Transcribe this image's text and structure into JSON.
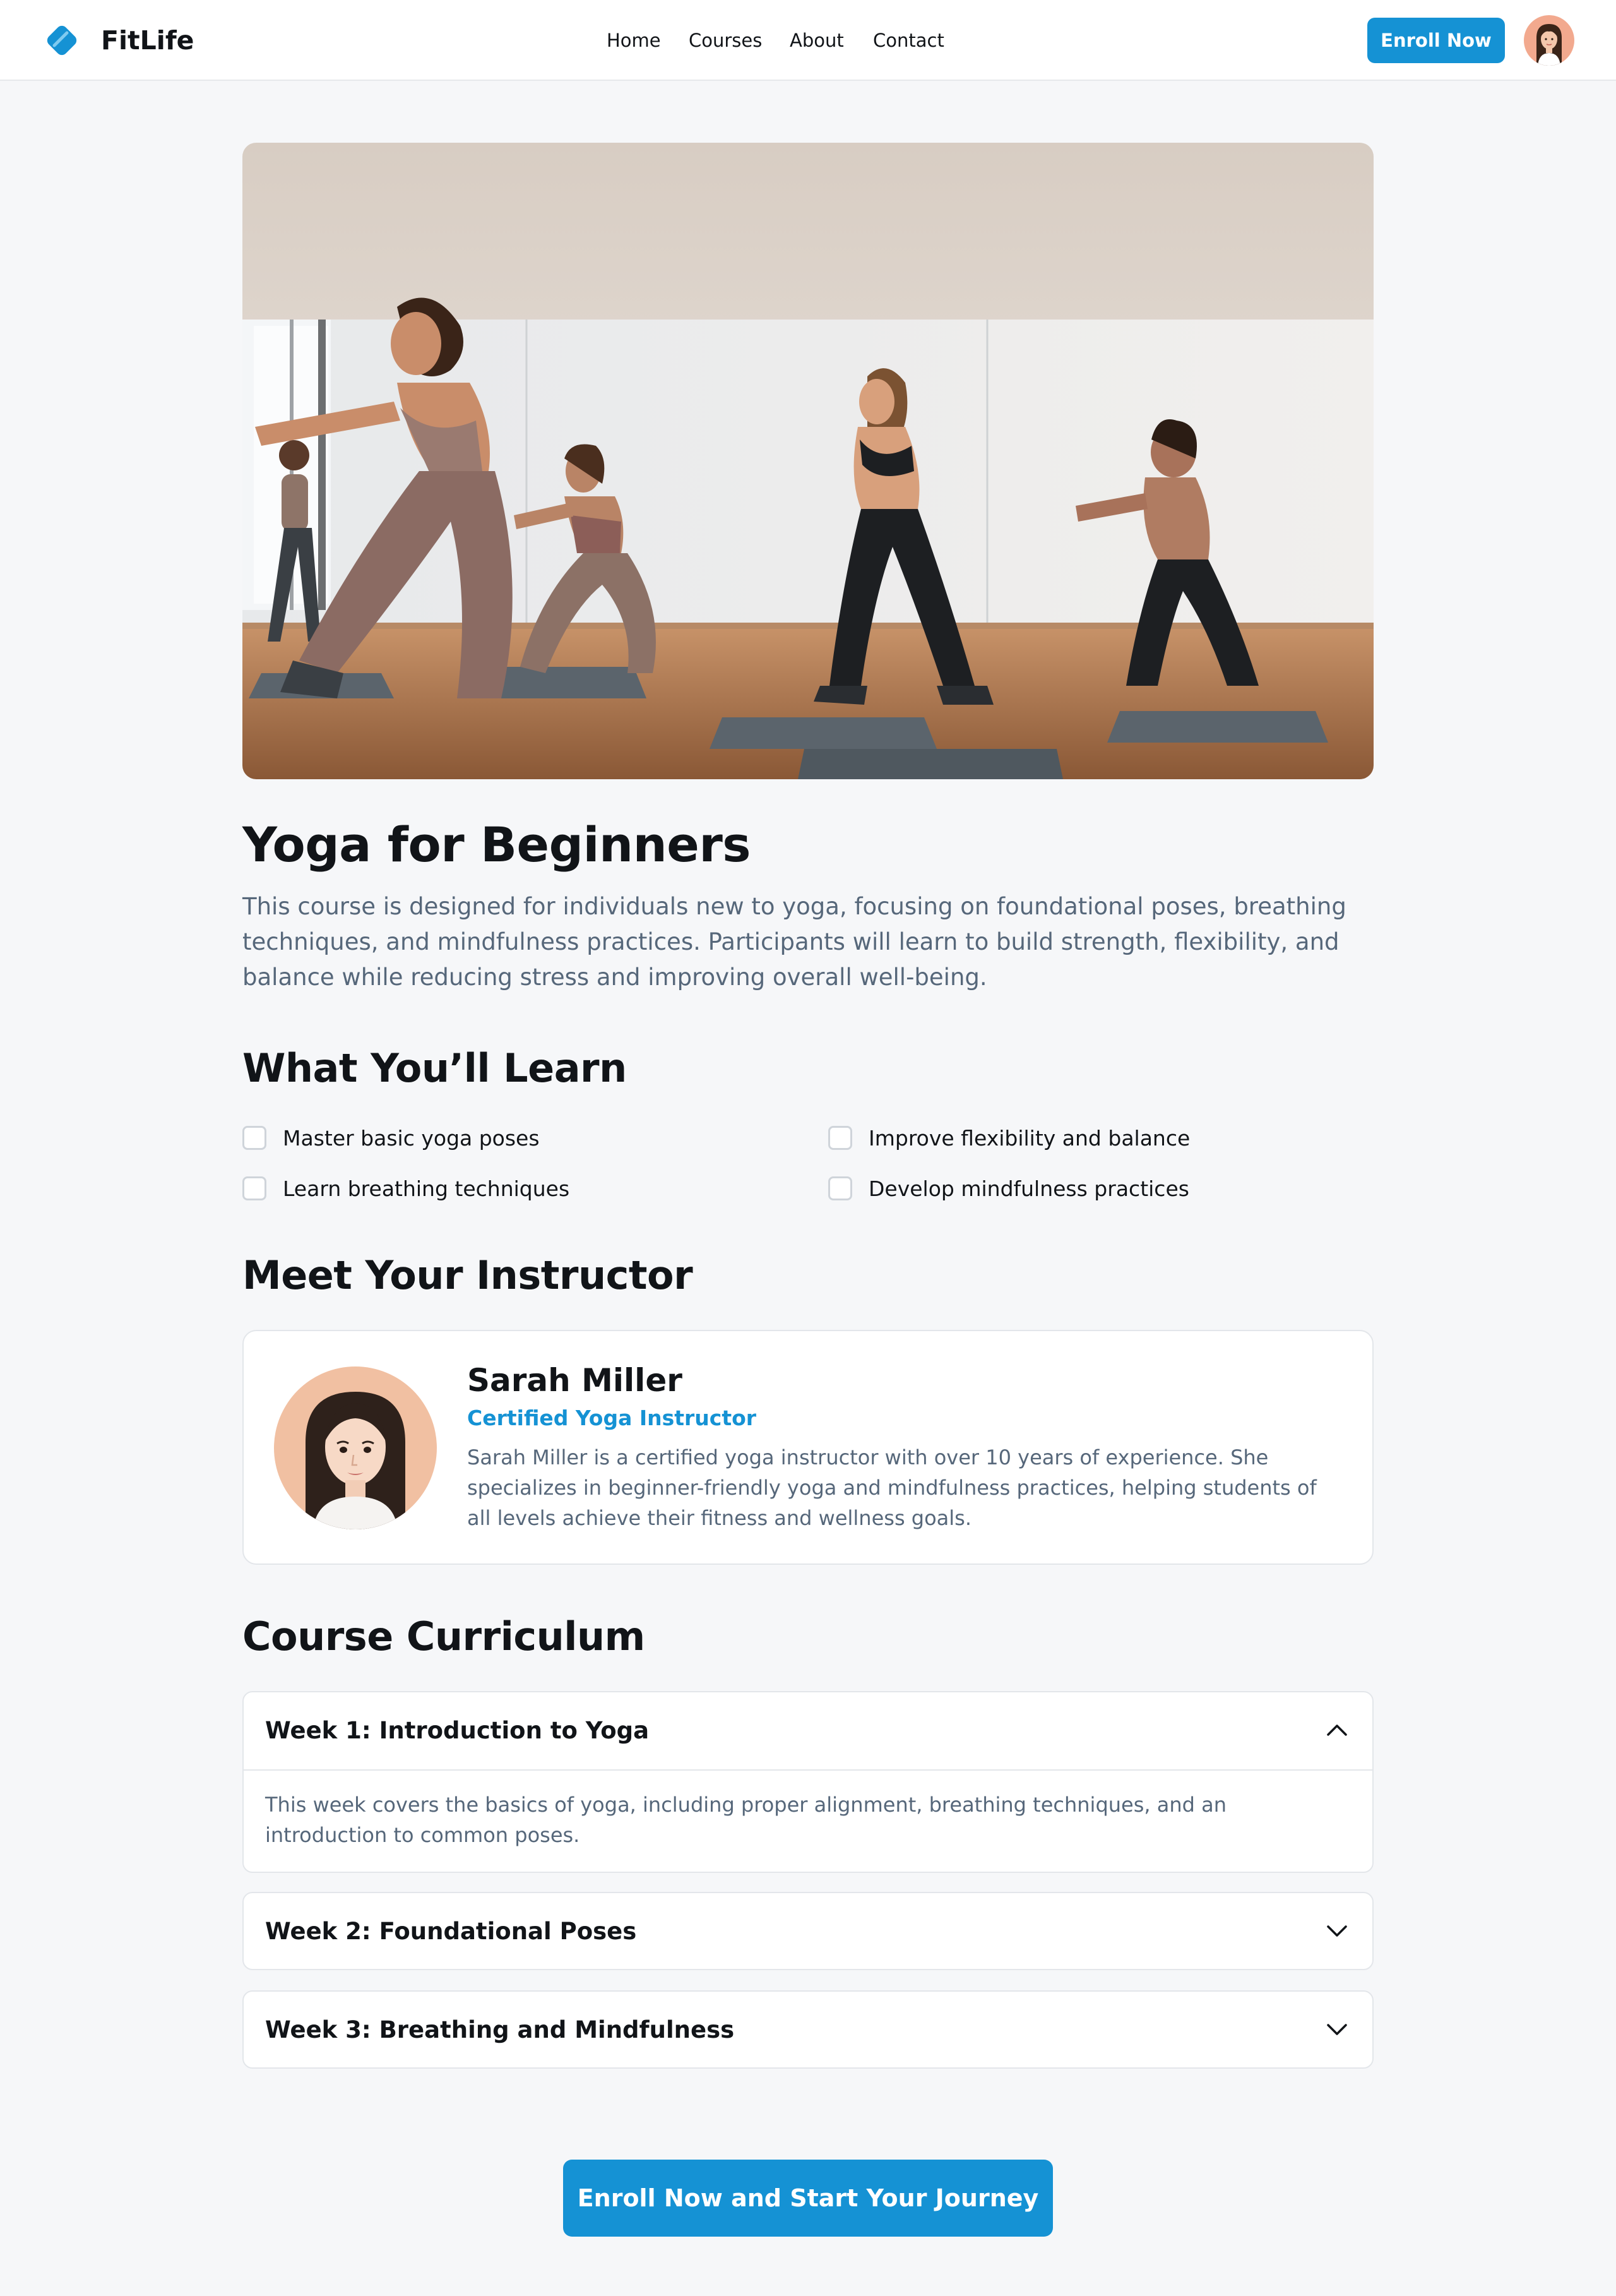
{
  "header": {
    "brand": "FitLife",
    "nav": [
      "Home",
      "Courses",
      "About",
      "Contact"
    ],
    "enroll_label": "Enroll Now",
    "avatar_icon": "user-avatar"
  },
  "course": {
    "title": "Yoga for Beginners",
    "description": "This course is designed for individuals new to yoga, focusing on foundational poses, breathing techniques, and mindfulness practices. Participants will learn to build strength, flexibility, and balance while reducing stress and improving overall well-being."
  },
  "learn": {
    "heading": "What You’ll Learn",
    "items": [
      "Master basic yoga poses",
      "Improve flexibility and balance",
      "Learn breathing techniques",
      "Develop mindfulness practices"
    ]
  },
  "instructor": {
    "heading": "Meet Your Instructor",
    "name": "Sarah Miller",
    "role": "Certified Yoga Instructor",
    "bio": "Sarah Miller is a certified yoga instructor with over 10 years of experience. She specializes in beginner-friendly yoga and mindfulness practices, helping students of all levels achieve their fitness and wellness goals."
  },
  "curriculum": {
    "heading": "Course Curriculum",
    "weeks": [
      {
        "title": "Week 1: Introduction to Yoga",
        "expanded": true,
        "body": "This week covers the basics of yoga, including proper alignment, breathing techniques, and an introduction to common poses."
      },
      {
        "title": "Week 2: Foundational Poses",
        "expanded": false
      },
      {
        "title": "Week 3: Breathing and Mindfulness",
        "expanded": false
      }
    ]
  },
  "cta": {
    "label": "Enroll Now and Start Your Journey"
  },
  "colors": {
    "accent": "#1592d4",
    "muted_text": "#56677a",
    "background": "#f6f7f9"
  }
}
